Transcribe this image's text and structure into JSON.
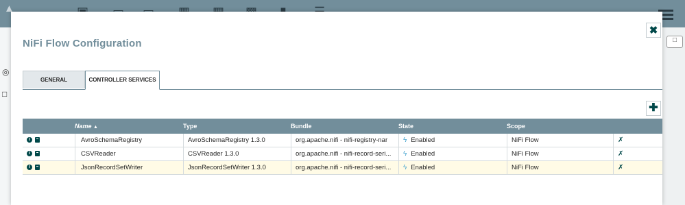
{
  "dialog": {
    "title": "NiFi Flow Configuration",
    "close_icon": "close-icon"
  },
  "tabs": [
    {
      "label": "GENERAL",
      "active": false
    },
    {
      "label": "CONTROLLER SERVICES",
      "active": true
    }
  ],
  "add_button": {
    "icon": "plus-icon"
  },
  "table": {
    "headers": {
      "name": "Name",
      "type": "Type",
      "bundle": "Bundle",
      "state": "State",
      "scope": "Scope"
    },
    "sort": {
      "column": "name",
      "direction": "ascending"
    },
    "rows": [
      {
        "name": "AvroSchemaRegistry",
        "type": "AvroSchemaRegistry 1.3.0",
        "bundle": "org.apache.nifi - nifi-registry-nar",
        "state": "Enabled",
        "scope": "NiFi Flow",
        "selected": false
      },
      {
        "name": "CSVReader",
        "type": "CSVReader 1.3.0",
        "bundle": "org.apache.nifi - nifi-record-seri...",
        "state": "Enabled",
        "scope": "NiFi Flow",
        "selected": false
      },
      {
        "name": "JsonRecordSetWriter",
        "type": "JsonRecordSetWriter 1.3.0",
        "bundle": "org.apache.nifi - nifi-record-seri...",
        "state": "Enabled",
        "scope": "NiFi Flow",
        "selected": true
      }
    ]
  },
  "colors": {
    "header_bg": "#728e9b",
    "accent_dark": "#004849",
    "enabled_bolt": "#44a3cf",
    "selected_row": "#fffbe6"
  }
}
